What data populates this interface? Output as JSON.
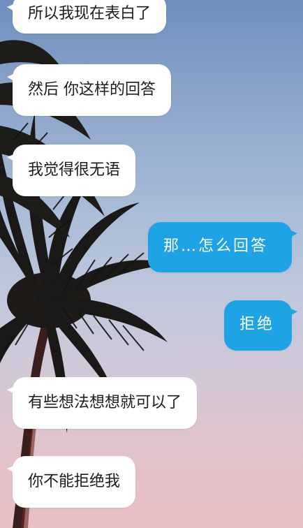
{
  "chat": {
    "messages": [
      {
        "side": "received",
        "text": "所以我现在表白了"
      },
      {
        "side": "received",
        "text": "然后 你这样的回答"
      },
      {
        "side": "received",
        "text": "我觉得很无语"
      },
      {
        "side": "sent",
        "text": "那…怎么回答"
      },
      {
        "side": "sent",
        "text": "拒绝"
      },
      {
        "side": "received",
        "text": "有些想法想想就可以了"
      },
      {
        "side": "received",
        "text": "你不能拒绝我"
      }
    ]
  },
  "colors": {
    "sent_bubble": "#1ea4e4",
    "received_bubble": "#ffffff",
    "received_text": "#1c1c1c",
    "sent_text": "#ffffff"
  },
  "icons": {
    "background": "palm-tree-silhouette"
  }
}
